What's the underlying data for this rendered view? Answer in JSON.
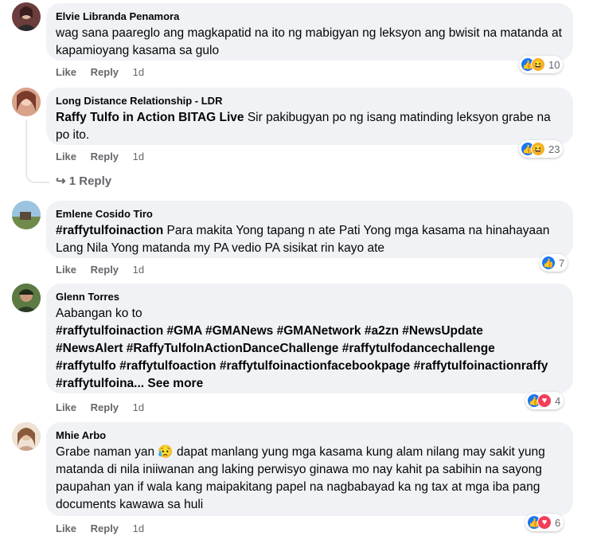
{
  "comments": [
    {
      "author": "Elvie Libranda Penamora",
      "text": "wag sana paareglo ang magkapatid na ito ng mabigyan ng leksyon ang bwisit na matanda at kapamioyang kasama sa gulo",
      "like": "Like",
      "reply": "Reply",
      "time": "1d",
      "count": "10",
      "reactions": [
        "like-icon",
        "haha-icon"
      ],
      "avatar_color": "#8b4a4a"
    },
    {
      "author": "Long Distance Relationship - LDR",
      "mention": "Raffy Tulfo in Action BITAG Live",
      "text": " Sir pakibugyan po ng isang matinding leksyon grabe na po ito.",
      "like": "Like",
      "reply": "Reply",
      "time": "1d",
      "count": "23",
      "reactions": [
        "like-icon",
        "haha-icon"
      ],
      "avatar_color": "#c98a6b",
      "replies_label": "1 Reply"
    },
    {
      "author": "Emlene Cosido Tiro",
      "mention": "#raffytulfoinaction",
      "text": " Para makita Yong tapang n ate Pati Yong mga kasama na hinahayaan Lang Nila Yong matanda my PA vedio PA sisikat rin kayo ate",
      "like": "Like",
      "reply": "Reply",
      "time": "1d",
      "count": "7",
      "reactions": [
        "like-icon"
      ],
      "avatar_color": "#6b8fb0"
    },
    {
      "author": "Glenn Torres",
      "line1": "Aabangan ko to",
      "tags": "#raffytulfoinaction #GMA #GMANews #GMANetwork #a2zn #NewsUpdate #NewsAlert #RaffyTulfoInActionDanceChallenge #raffytulfodancechallenge #raffytulfo #raffytulfoaction #raffytulfoinactionfacebookpage #raffytulfoinactionraffy #raffytulfoina...",
      "see_more": "See more",
      "like": "Like",
      "reply": "Reply",
      "time": "1d",
      "count": "4",
      "reactions": [
        "like-icon",
        "love-icon"
      ],
      "avatar_color": "#4d6b3a"
    },
    {
      "author": "Mhie Arbo",
      "text_a": "Grabe naman yan ",
      "emoji": "😥",
      "text_b": " dapat manlang yung mga kasama kung alam nilang may sakit yung matanda di nila iniiwanan ang laking perwisyo ginawa mo nay kahit pa sabihin na sayong paupahan yan if wala kang maipakitang papel na nagbabayad ka ng tax at mga iba pang documents kawawa sa huli",
      "like": "Like",
      "reply": "Reply",
      "time": "1d",
      "count": "6",
      "reactions": [
        "like-icon",
        "love-icon"
      ],
      "avatar_color": "#d9b08c"
    }
  ]
}
